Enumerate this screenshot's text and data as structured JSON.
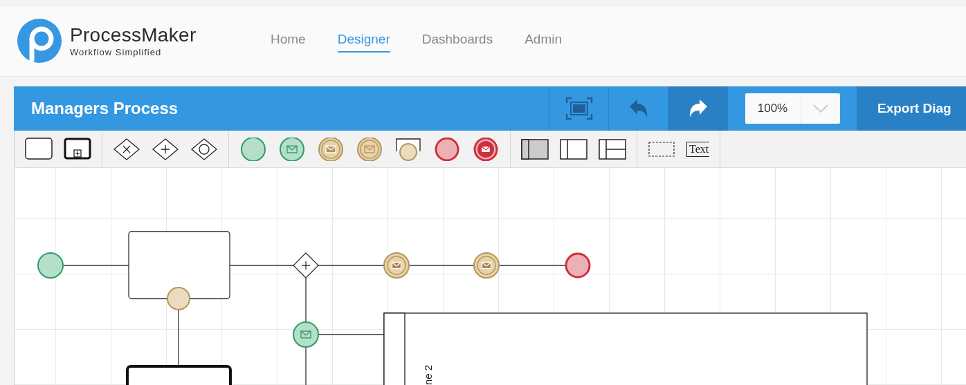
{
  "brand": {
    "name": "ProcessMaker",
    "tagline": "Workflow Simplified"
  },
  "nav": [
    {
      "label": "Home",
      "selected": false
    },
    {
      "label": "Designer",
      "selected": true
    },
    {
      "label": "Dashboards",
      "selected": false
    },
    {
      "label": "Admin",
      "selected": false
    }
  ],
  "editor": {
    "title": "Managers Process",
    "actions": [
      {
        "kind": "fit",
        "active": false
      },
      {
        "kind": "undo",
        "active": false
      },
      {
        "kind": "redo",
        "active": true
      }
    ],
    "zoom": {
      "value": "100%"
    },
    "export_button": "Export Diag"
  },
  "toolbar": [
    {
      "items": [
        {
          "kind": "task"
        },
        {
          "kind": "subprocess"
        }
      ]
    },
    {
      "items": [
        {
          "kind": "gateway-exclusive"
        },
        {
          "kind": "gateway-parallel"
        },
        {
          "kind": "gateway-inclusive"
        }
      ]
    },
    {
      "items": [
        {
          "kind": "start"
        },
        {
          "kind": "start-message"
        },
        {
          "kind": "message-catch"
        },
        {
          "kind": "message-throw"
        },
        {
          "kind": "boundary"
        },
        {
          "kind": "end"
        },
        {
          "kind": "end-message"
        }
      ]
    },
    {
      "items": [
        {
          "kind": "pool"
        },
        {
          "kind": "lane"
        },
        {
          "kind": "lanes"
        }
      ]
    },
    {
      "items": [
        {
          "kind": "group"
        },
        {
          "kind": "annotation",
          "label": "Text"
        }
      ]
    }
  ],
  "diagram": {
    "lane_label": "ne 2"
  }
}
